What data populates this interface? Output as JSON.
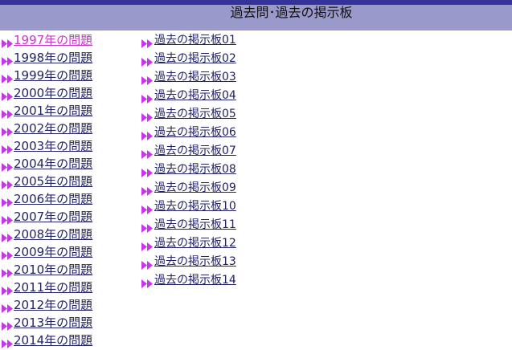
{
  "header": {
    "title": "過去問･過去の掲示板"
  },
  "colors": {
    "top_bar": "#33339a",
    "header_bar": "#9999cc",
    "link": "#222266",
    "active_link": "#cc33cc",
    "marker": "#cc33ee"
  },
  "marker_icon": "double-triangle-arrow",
  "years": {
    "items": [
      {
        "label": "1997年の問題",
        "active": true
      },
      {
        "label": "1998年の問題",
        "active": false
      },
      {
        "label": "1999年の問題",
        "active": false
      },
      {
        "label": "2000年の問題",
        "active": false
      },
      {
        "label": "2001年の問題",
        "active": false
      },
      {
        "label": "2002年の問題",
        "active": false
      },
      {
        "label": "2003年の問題",
        "active": false
      },
      {
        "label": "2004年の問題",
        "active": false
      },
      {
        "label": "2005年の問題",
        "active": false
      },
      {
        "label": "2006年の問題",
        "active": false
      },
      {
        "label": "2007年の問題",
        "active": false
      },
      {
        "label": "2008年の問題",
        "active": false
      },
      {
        "label": "2009年の問題",
        "active": false
      },
      {
        "label": "2010年の問題",
        "active": false
      },
      {
        "label": "2011年の問題",
        "active": false
      },
      {
        "label": "2012年の問題",
        "active": false
      },
      {
        "label": "2013年の問題",
        "active": false
      },
      {
        "label": "2014年の問題",
        "active": false
      }
    ]
  },
  "boards": {
    "items": [
      {
        "label": "過去の掲示板01"
      },
      {
        "label": "過去の掲示板02"
      },
      {
        "label": "過去の掲示板03"
      },
      {
        "label": "過去の掲示板04"
      },
      {
        "label": "過去の掲示板05"
      },
      {
        "label": "過去の掲示板06"
      },
      {
        "label": "過去の掲示板07"
      },
      {
        "label": "過去の掲示板08"
      },
      {
        "label": "過去の掲示板09"
      },
      {
        "label": "過去の掲示板10"
      },
      {
        "label": "過去の掲示板11"
      },
      {
        "label": "過去の掲示板12"
      },
      {
        "label": "過去の掲示板13"
      },
      {
        "label": "過去の掲示板14"
      }
    ]
  }
}
